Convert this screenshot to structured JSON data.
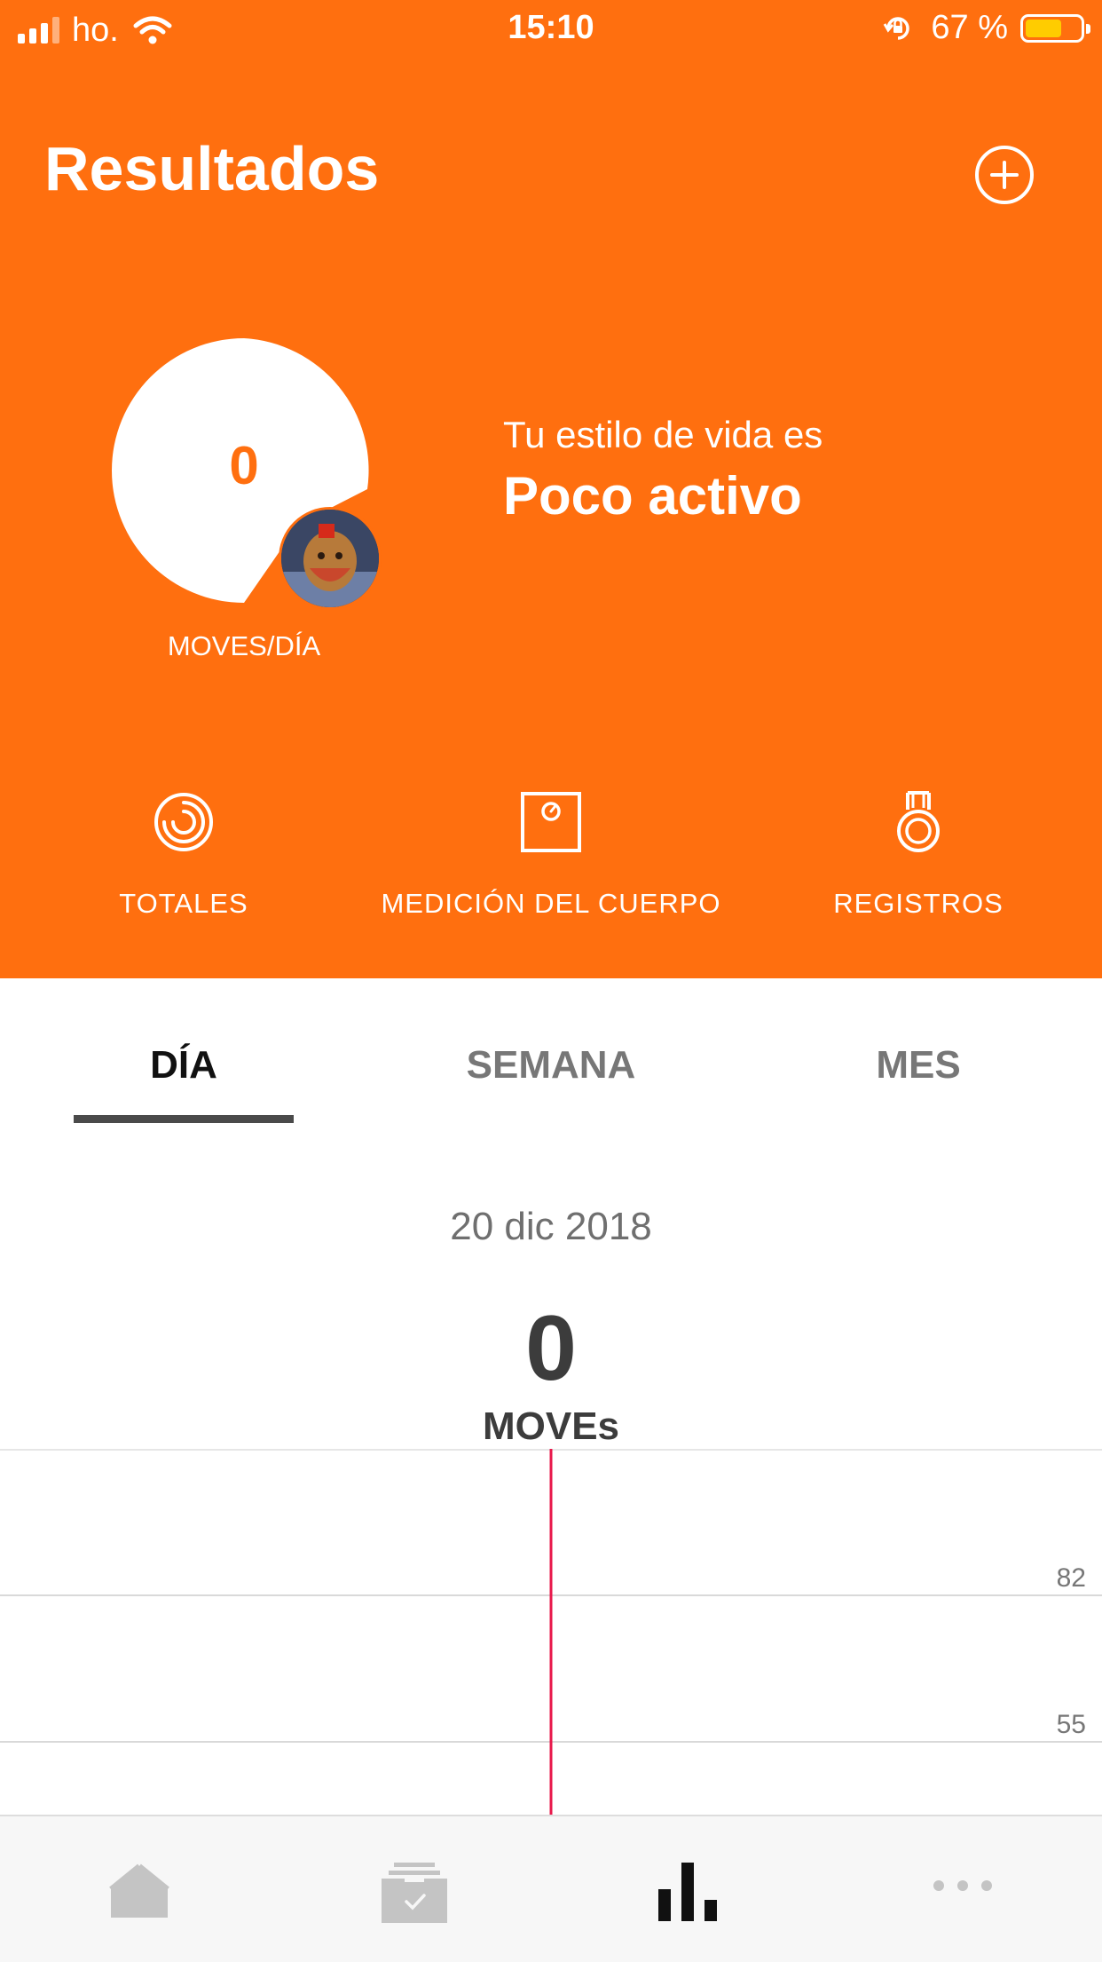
{
  "status_bar": {
    "carrier": "ho.",
    "time": "15:10",
    "battery_percent": "67 %",
    "battery_level": 0.67,
    "battery_color": "#ffcc00"
  },
  "header": {
    "title": "Resultados",
    "add_icon": "plus-circle-icon"
  },
  "score": {
    "value": "0",
    "unit": "MOVES/DÍA",
    "lifestyle_label": "Tu estilo de vida es",
    "lifestyle_value": "Poco activo"
  },
  "quick_actions": [
    {
      "label": "TOTALES",
      "icon": "spiral-icon"
    },
    {
      "label": "MEDICIÓN DEL CUERPO",
      "icon": "scale-icon"
    },
    {
      "label": "REGISTROS",
      "icon": "medal-icon"
    }
  ],
  "tabs": [
    {
      "label": "DÍA",
      "active": true
    },
    {
      "label": "SEMANA",
      "active": false
    },
    {
      "label": "MES",
      "active": false
    }
  ],
  "day": {
    "date": "20 dic 2018",
    "value": "0",
    "unit": "MOVEs"
  },
  "chart_data": {
    "type": "bar",
    "x": [],
    "values": [],
    "y_ticks": [
      82,
      55
    ],
    "marker_color": "#e8174a",
    "grid": true
  },
  "bottom_nav": [
    {
      "icon": "home-icon",
      "active": false
    },
    {
      "icon": "inbox-check-icon",
      "active": false
    },
    {
      "icon": "bar-chart-icon",
      "active": true
    },
    {
      "icon": "more-dots-icon",
      "active": false
    }
  ],
  "colors": {
    "brand": "#ff6f0f",
    "active_nav": "#111111",
    "inactive_nav": "#c4c4c4"
  }
}
